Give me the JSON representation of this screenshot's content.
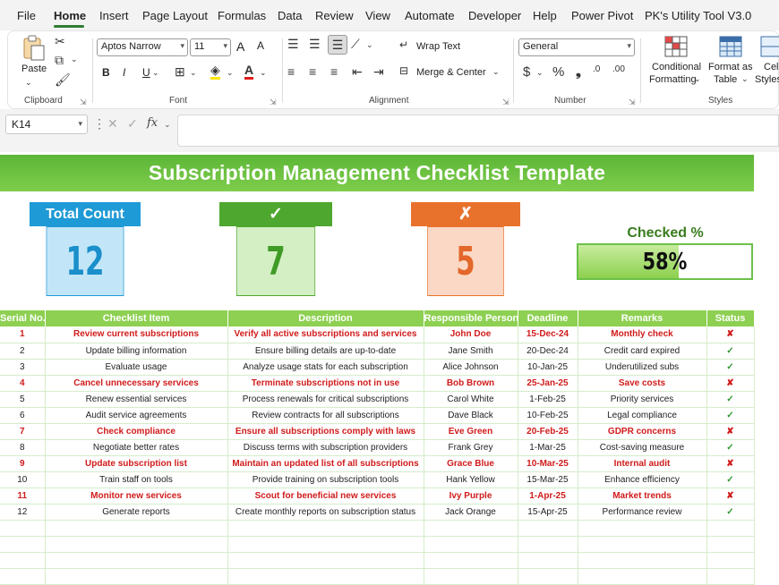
{
  "menu": [
    "File",
    "Home",
    "Insert",
    "Page Layout",
    "Formulas",
    "Data",
    "Review",
    "View",
    "Automate",
    "Developer",
    "Help",
    "Power Pivot",
    "PK's Utility Tool V3.0"
  ],
  "ribbon": {
    "paste_label": "Paste",
    "clipboard_label": "Clipboard",
    "font_name": "Aptos Narrow",
    "font_size": "11",
    "font_label": "Font",
    "wrap_text": "Wrap Text",
    "merge_center": "Merge & Center",
    "alignment_label": "Alignment",
    "number_format": "General",
    "number_label": "Number",
    "conditional_formatting": [
      "Conditional",
      "Formatting"
    ],
    "format_as_table": [
      "Format as",
      "Table"
    ],
    "cell_styles": [
      "Cell",
      "Styles"
    ],
    "styles_label": "Styles",
    "bold": "B",
    "italic": "I",
    "underline": "U",
    "increase_font": "A",
    "decrease_font": "A"
  },
  "formula_bar": {
    "name_box": "K14",
    "fx": "fx",
    "value": ""
  },
  "sheet": {
    "title": "Subscription Management Checklist Template",
    "cards": {
      "total": {
        "label": "Total Count",
        "value": "12",
        "head_color": "#1e9ad6",
        "body_color": "#c2e6f7",
        "text_color": "#1a8fcb"
      },
      "checked": {
        "label": "✓",
        "value": "7",
        "head_color": "#4ea72e",
        "body_color": "#d4efc4",
        "text_color": "#3f9b25"
      },
      "unchecked": {
        "label": "✗",
        "value": "5",
        "head_color": "#e8722c",
        "body_color": "#fad8c5",
        "text_color": "#e3672a"
      }
    },
    "checked_pct": {
      "label": "Checked %",
      "value": 0.58,
      "display": "58%"
    },
    "columns": [
      "Serial No.",
      "Checklist Item",
      "Description",
      "Responsible Person",
      "Deadline",
      "Remarks",
      "Status"
    ],
    "rows": [
      {
        "no": "1",
        "item": "Review current subscriptions",
        "desc": "Verify all active subscriptions and services",
        "person": "John Doe",
        "deadline": "15-Dec-24",
        "remarks": "Monthly check",
        "status": "✘",
        "done": false
      },
      {
        "no": "2",
        "item": "Update billing information",
        "desc": "Ensure billing details are up-to-date",
        "person": "Jane Smith",
        "deadline": "20-Dec-24",
        "remarks": "Credit card expired",
        "status": "✓",
        "done": true
      },
      {
        "no": "3",
        "item": "Evaluate usage",
        "desc": "Analyze usage stats for each subscription",
        "person": "Alice Johnson",
        "deadline": "10-Jan-25",
        "remarks": "Underutilized subs",
        "status": "✓",
        "done": true
      },
      {
        "no": "4",
        "item": "Cancel unnecessary services",
        "desc": "Terminate subscriptions not in use",
        "person": "Bob Brown",
        "deadline": "25-Jan-25",
        "remarks": "Save costs",
        "status": "✘",
        "done": false
      },
      {
        "no": "5",
        "item": "Renew essential services",
        "desc": "Process renewals for critical subscriptions",
        "person": "Carol White",
        "deadline": "1-Feb-25",
        "remarks": "Priority services",
        "status": "✓",
        "done": true
      },
      {
        "no": "6",
        "item": "Audit service agreements",
        "desc": "Review contracts for all subscriptions",
        "person": "Dave Black",
        "deadline": "10-Feb-25",
        "remarks": "Legal compliance",
        "status": "✓",
        "done": true
      },
      {
        "no": "7",
        "item": "Check compliance",
        "desc": "Ensure all subscriptions comply with laws",
        "person": "Eve Green",
        "deadline": "20-Feb-25",
        "remarks": "GDPR concerns",
        "status": "✘",
        "done": false
      },
      {
        "no": "8",
        "item": "Negotiate better rates",
        "desc": "Discuss terms with subscription providers",
        "person": "Frank Grey",
        "deadline": "1-Mar-25",
        "remarks": "Cost-saving measure",
        "status": "✓",
        "done": true
      },
      {
        "no": "9",
        "item": "Update subscription list",
        "desc": "Maintain an updated list of all subscriptions",
        "person": "Grace Blue",
        "deadline": "10-Mar-25",
        "remarks": "Internal audit",
        "status": "✘",
        "done": false
      },
      {
        "no": "10",
        "item": "Train staff on tools",
        "desc": "Provide training on subscription tools",
        "person": "Hank Yellow",
        "deadline": "15-Mar-25",
        "remarks": "Enhance efficiency",
        "status": "✓",
        "done": true
      },
      {
        "no": "11",
        "item": "Monitor new services",
        "desc": "Scout for beneficial new services",
        "person": "Ivy Purple",
        "deadline": "1-Apr-25",
        "remarks": "Market trends",
        "status": "✘",
        "done": false
      },
      {
        "no": "12",
        "item": "Generate reports",
        "desc": "Create monthly reports on subscription status",
        "person": "Jack Orange",
        "deadline": "15-Apr-25",
        "remarks": "Performance review",
        "status": "✓",
        "done": true
      }
    ]
  }
}
